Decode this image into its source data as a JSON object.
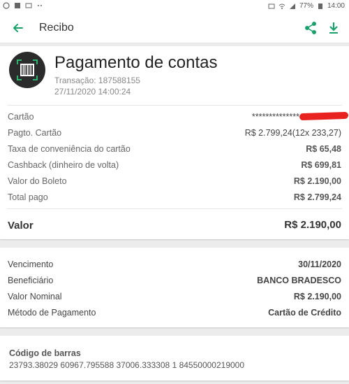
{
  "status_bar": {
    "battery_percent": "77%",
    "time": "14:00"
  },
  "appbar": {
    "title": "Recibo",
    "accent_color": "#1aa06a"
  },
  "receipt": {
    "heading": "Pagamento de contas",
    "transaction": "Transação: 187588155",
    "datetime": "27/11/2020 14:00:24",
    "rows": [
      {
        "label": "Cartão",
        "value": "**************"
      },
      {
        "label": "Pagto. Cartão",
        "value": "R$ 2.799,24(12x 233,27)"
      },
      {
        "label": "Taxa de conveniência do cartão",
        "value": "R$ 65,48"
      },
      {
        "label": "Cashback (dinheiro de volta)",
        "value": "R$ 699,81"
      },
      {
        "label": "Valor do Boleto",
        "value": "R$ 2.190,00"
      },
      {
        "label": "Total pago",
        "value": "R$ 2.799,24"
      }
    ],
    "total_label": "Valor",
    "total_value": "R$ 2.190,00"
  },
  "details": {
    "rows": [
      {
        "label": "Vencimento",
        "value": "30/11/2020"
      },
      {
        "label": "Beneficiário",
        "value": "BANCO BRADESCO"
      },
      {
        "label": "Valor Nominal",
        "value": "R$ 2.190,00"
      },
      {
        "label": "Método de Pagamento",
        "value": "Cartão de Crédito"
      }
    ]
  },
  "barcode": {
    "label": "Código de barras",
    "number": "23793.38029 60967.795588 37006.333308 1 84550000219000"
  }
}
